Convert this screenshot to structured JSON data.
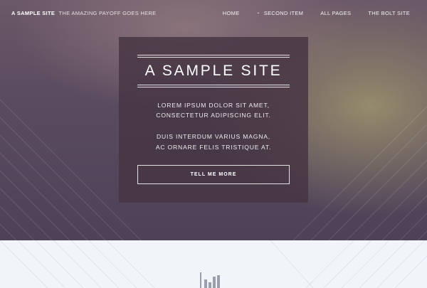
{
  "header": {
    "brand_name": "A SAMPLE SITE",
    "brand_tagline": "THE AMAZING PAYOFF GOES HERE",
    "nav": [
      {
        "label": "HOME",
        "has_dropdown": false
      },
      {
        "label": "SECOND ITEM",
        "has_dropdown": true
      },
      {
        "label": "ALL PAGES",
        "has_dropdown": false
      },
      {
        "label": "THE BOLT SITE",
        "has_dropdown": false
      }
    ]
  },
  "hero": {
    "title": "A SAMPLE SITE",
    "text_line_1": "LOREM IPSUM DOLOR SIT AMET,",
    "text_line_2": "CONSECTETUR ADIPISCING ELIT.",
    "text_line_3": "DUIS INTERDUM VARIUS MAGNA,",
    "text_line_4": "AC ORNARE FELIS TRISTIQUE AT.",
    "button_label": "TELL ME MORE"
  },
  "icons": {
    "dropdown": "chevron-down-icon",
    "lower_section": "bar-chart-icon"
  },
  "colors": {
    "hero_overlay": "#46344299",
    "hero_base": "#5a4a5f",
    "hero_highlight": "#a0966e",
    "lower_background": "#f1f4f8",
    "text": "#ffffff"
  }
}
